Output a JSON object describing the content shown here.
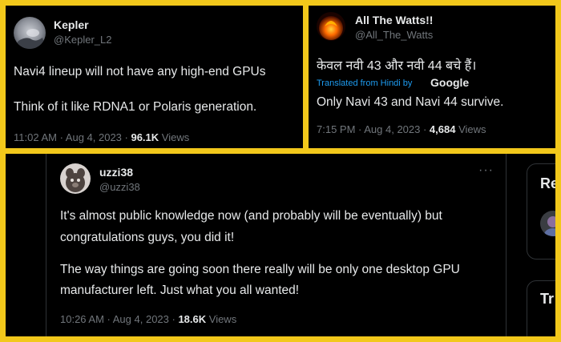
{
  "tweet1": {
    "name": "Kepler",
    "handle": "@Kepler_L2",
    "line1": "Navi4 lineup will not have any high-end GPUs",
    "line2": "Think of it like RDNA1 or Polaris generation.",
    "time": "11:02 AM · Aug 4, 2023 · ",
    "views_count": "96.1K",
    "views_label": " Views"
  },
  "tweet2": {
    "name": "All The Watts!!",
    "handle": "@All_The_Watts",
    "hindi": "केवल नवी 43 और नवी 44 बचे हैं।",
    "translated_label": "Translated from Hindi by",
    "translator": "Google",
    "translation": "Only Navi 43 and Navi 44 survive.",
    "time": "7:15 PM · Aug 4, 2023 · ",
    "views_count": "4,684",
    "views_label": " Views"
  },
  "tweet3": {
    "name": "uzzi38",
    "handle": "@uzzi38",
    "more": "···",
    "p1_line1": "It's almost public knowledge now (and probably will be eventually) but",
    "p1_line2": "congratulations guys, you did it!",
    "p2_line1": "The way things are going soon there really will be only one desktop GPU",
    "p2_line2": "manufacturer left. Just what you all wanted!",
    "time": "10:26 AM · Aug 4, 2023 · ",
    "views_count": "18.6K",
    "views_label": " Views"
  },
  "sidebar": {
    "card1_fragment": "Re",
    "card2_fragment": "Tr"
  },
  "colors": {
    "frame": "#f2c81b",
    "background": "#000000",
    "text": "#e7e9ea",
    "secondary": "#71767b",
    "link": "#1d9bf0"
  }
}
